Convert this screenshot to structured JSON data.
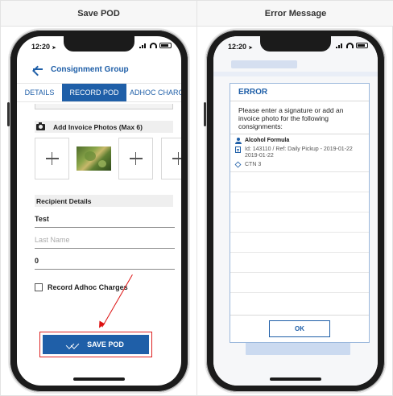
{
  "headers": {
    "left": "Save POD",
    "right": "Error Message"
  },
  "status": {
    "time": "12:20",
    "location_glyph": "➤"
  },
  "left_screen": {
    "app_title": "Consignment Group",
    "tabs": [
      "DETAILS",
      "RECORD POD",
      "ADHOC CHARGES"
    ],
    "photos_section": "Add Invoice Photos (Max 6)",
    "recipient_section": "Recipient Details",
    "first_name_value": "Test",
    "last_name_placeholder": "Last Name",
    "quantity_value": "0",
    "record_adhoc_label": "Record Adhoc Charges",
    "save_label": "SAVE POD"
  },
  "right_screen": {
    "error_title": "ERROR",
    "error_message": "Please enter a signature or add an invoice photo for the following consignments:",
    "consignment": {
      "name": "Alcohol Formula",
      "ref_line": "Id: 143110 / Ref: Daily Pickup - 2019-01-22 2019-01-22",
      "ctn": "CTN 3"
    },
    "ok_label": "OK"
  },
  "colors": {
    "primary": "#1f5fa8",
    "highlight": "#dd2222"
  }
}
